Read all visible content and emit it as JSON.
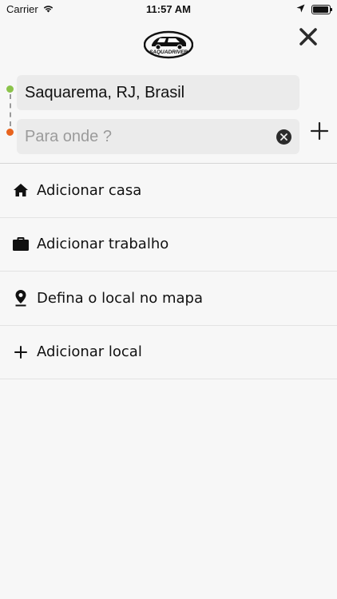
{
  "status_bar": {
    "carrier": "Carrier",
    "time": "11:57 AM",
    "battery_level": 0.95
  },
  "header": {
    "logo_text": "SAQUADRIVER",
    "close_icon": "close-icon"
  },
  "route": {
    "origin_value": "Saquarema, RJ, Brasil",
    "destination_placeholder": "Para onde ?",
    "destination_value": "",
    "origin_color": "#8bc34a",
    "destination_color": "#e8641e"
  },
  "menu": {
    "items": [
      {
        "label": "Adicionar casa",
        "icon": "home-icon"
      },
      {
        "label": "Adicionar trabalho",
        "icon": "briefcase-icon"
      },
      {
        "label": "Defina o local no mapa",
        "icon": "location-pin-icon"
      },
      {
        "label": "Adicionar local",
        "icon": "plus-icon"
      }
    ]
  }
}
